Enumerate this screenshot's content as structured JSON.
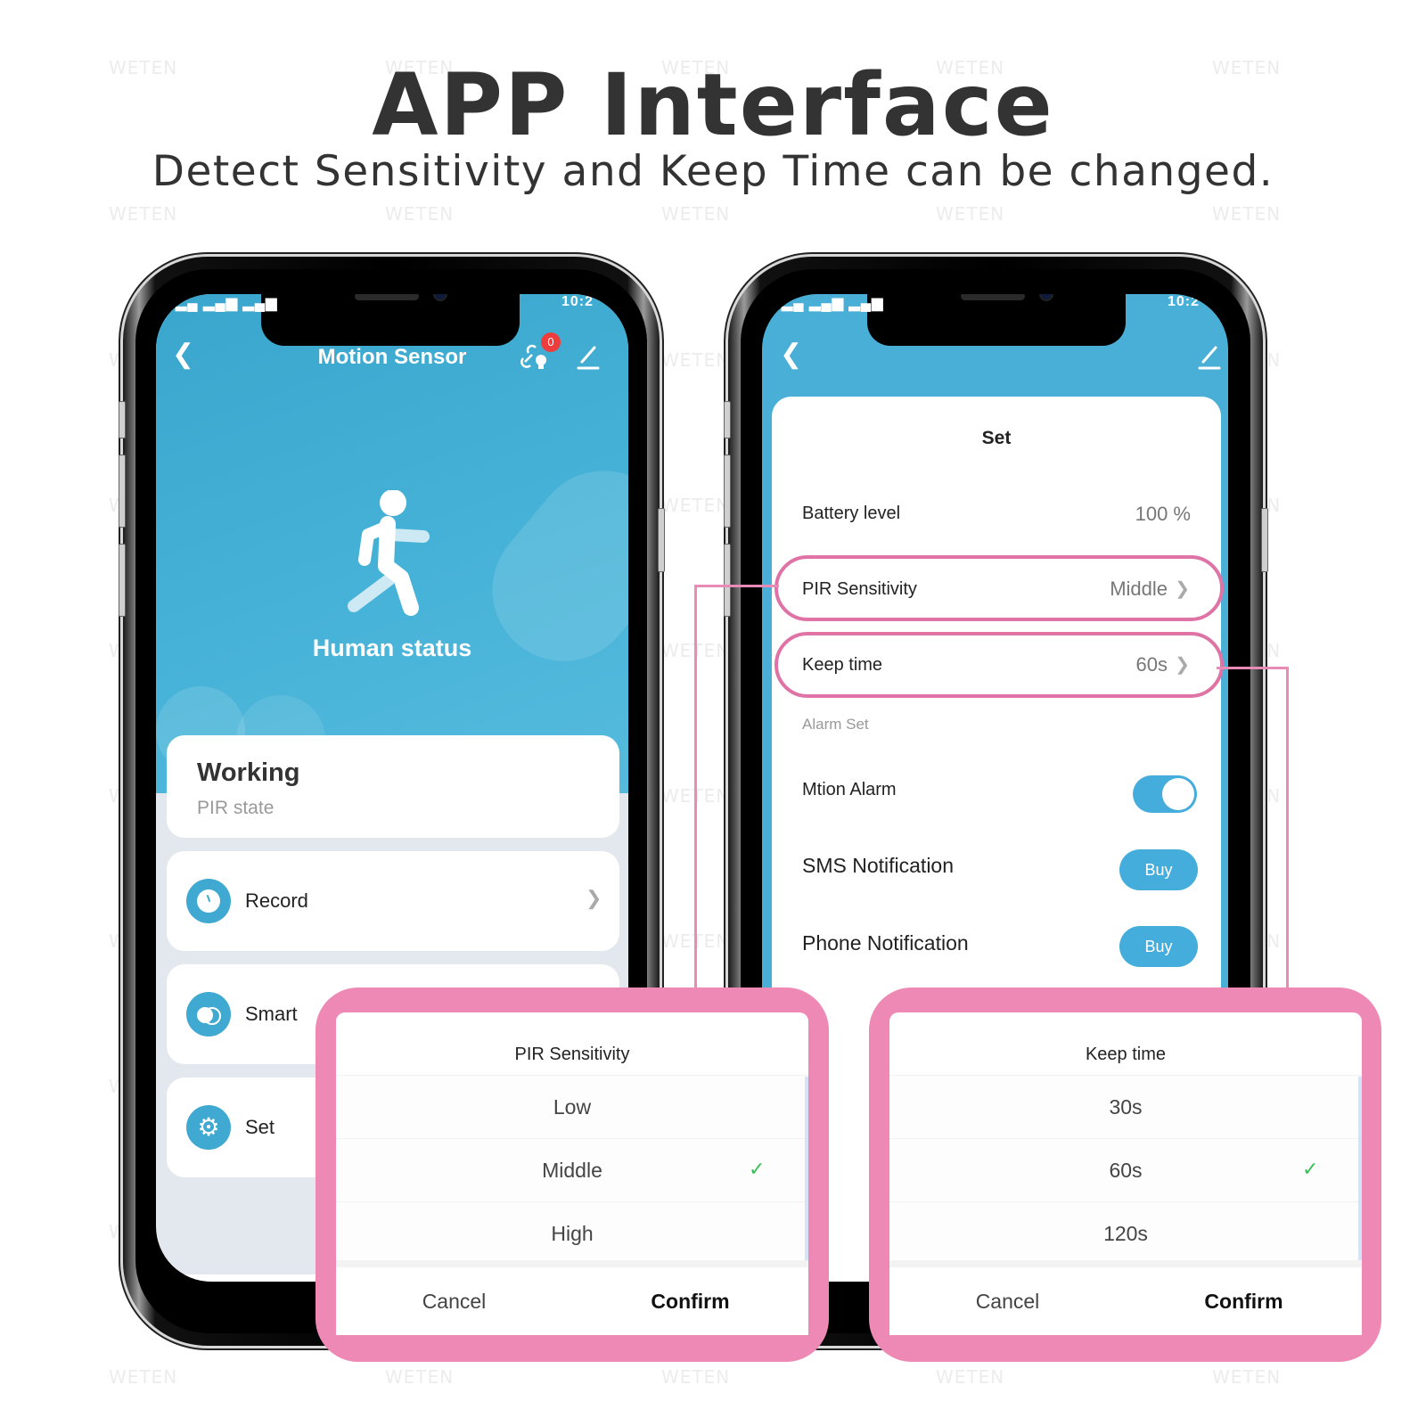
{
  "header": {
    "title": "APP Interface",
    "subtitle": "Detect Sensitivity and Keep Time can be changed."
  },
  "watermark": "WETEN",
  "colors": {
    "accent_blue": "#45addb",
    "highlight_pink": "#ee88b4",
    "check_green": "#3bbf5a"
  },
  "left_phone": {
    "status_time": "10:2",
    "nav": {
      "back_icon": "chevron-left-icon",
      "title": "Motion Sensor",
      "badge_count": "0",
      "link_icon": "link-bulb-icon",
      "edit_icon": "pencil-icon"
    },
    "hero": {
      "icon": "walking-person-icon",
      "label": "Human status"
    },
    "state_card": {
      "value": "Working",
      "caption": "PIR state"
    },
    "menu": [
      {
        "icon": "clock-icon",
        "label": "Record"
      },
      {
        "icon": "toggle-circles-icon",
        "label": "Smart"
      },
      {
        "icon": "gear-icon",
        "label": "Set"
      }
    ],
    "back_nav_icon": "triangle-back-icon"
  },
  "right_phone": {
    "status_time": "10:2",
    "panel_title": "Set",
    "rows": {
      "battery": {
        "label": "Battery level",
        "value": "100 %"
      },
      "pir": {
        "label": "PIR Sensitivity",
        "value": "Middle"
      },
      "keep": {
        "label": "Keep time",
        "value": "60s"
      },
      "section": "Alarm Set",
      "motion_alarm": {
        "label": "Mtion Alarm",
        "enabled": true
      },
      "sms": {
        "label": "SMS Notification",
        "button": "Buy"
      },
      "phone": {
        "label": "Phone Notification",
        "button": "Buy"
      }
    }
  },
  "pir_dialog": {
    "title": "PIR Sensitivity",
    "options": [
      "Low",
      "Middle",
      "High"
    ],
    "selected": "Middle",
    "cancel": "Cancel",
    "confirm": "Confirm"
  },
  "keep_dialog": {
    "title": "Keep time",
    "options": [
      "30s",
      "60s",
      "120s"
    ],
    "selected": "60s",
    "cancel": "Cancel",
    "confirm": "Confirm"
  }
}
